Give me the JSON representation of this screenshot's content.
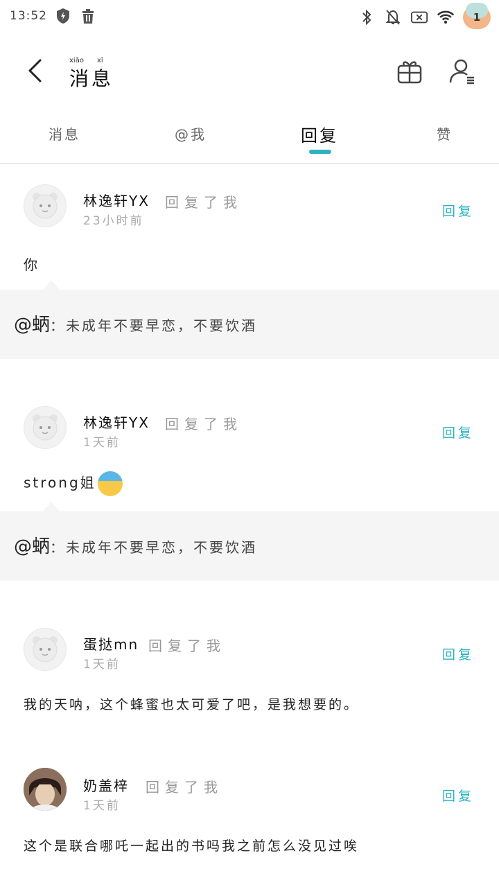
{
  "status_bar": {
    "time": "13:52",
    "notification_count": "1"
  },
  "header": {
    "title": "消息",
    "title_pinyin": [
      "xiāo",
      "xī"
    ]
  },
  "tabs": [
    {
      "label": "消息",
      "active": false
    },
    {
      "label": "@我",
      "active": false
    },
    {
      "label": "回复",
      "active": true
    },
    {
      "label": "赞",
      "active": false
    }
  ],
  "messages": [
    {
      "user": "林逸轩YX",
      "action": "回复了我",
      "time": "23小时前",
      "reply_label": "回复",
      "content": "你",
      "has_emoji": false,
      "quote": {
        "user": "@蛃",
        "text": "：未成年不要早恋，不要饮酒"
      },
      "avatar": "bear-avatar"
    },
    {
      "user": "林逸轩YX",
      "action": "回复了我",
      "time": "1天前",
      "reply_label": "回复",
      "content": "strong姐",
      "has_emoji": true,
      "quote": {
        "user": "@蛃",
        "text": "：未成年不要早恋，不要饮酒"
      },
      "avatar": "bear-avatar"
    },
    {
      "user": "蛋挞mn",
      "action": "回复了我",
      "time": "1天前",
      "reply_label": "回复",
      "content": "我的天呐，这个蜂蜜也太可爱了吧，是我想要的。",
      "has_emoji": false,
      "avatar": "bear-avatar"
    },
    {
      "user": "奶盖梓",
      "action": "回复了我",
      "time": "1天前",
      "reply_label": "回复",
      "content": "这个是联合哪吒一起出的书吗我之前怎么没见过唉",
      "has_emoji": false,
      "avatar": "photo-avatar"
    }
  ],
  "colors": {
    "accent": "#2bb3c0",
    "quote_bg": "#f5f5f5",
    "secondary_text": "#999999"
  }
}
